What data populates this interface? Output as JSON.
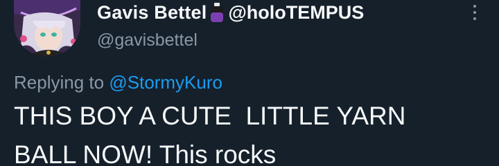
{
  "tweet": {
    "display_name": "Gavis Bettel",
    "name_emoji": "purple-bottle-emoji",
    "name_suffix": "@holoTEMPUS",
    "handle": "@gavisbettel",
    "replying_prefix": "Replying to",
    "replying_to": "@StormyKuro",
    "text": "THIS BOY A CUTE  LITTLE YARN\nBALL NOW! This rocks",
    "more_icon": "more-vertical-icon"
  },
  "colors": {
    "background": "#15202b",
    "primary_text": "#f7f9f9",
    "secondary_text": "#8b98a5",
    "link": "#1d9bf0"
  }
}
